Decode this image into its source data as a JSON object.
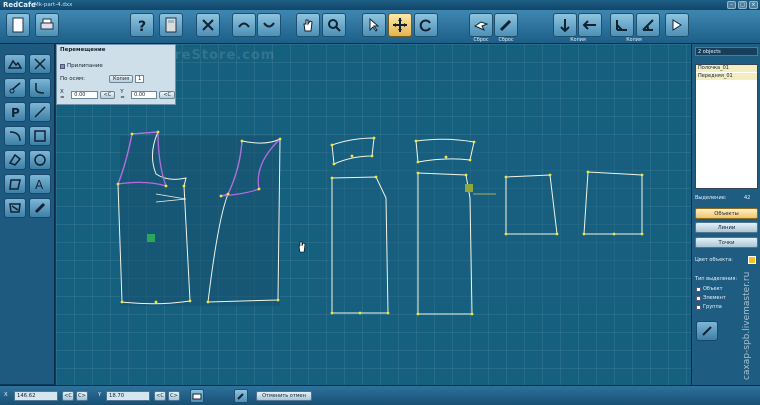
{
  "window": {
    "logo": "RedCafe",
    "file": "Mk-part-4.dxx"
  },
  "toolbar": {
    "label_reset_1": "Сброс",
    "label_reset_2": "Сброс",
    "label_copy_1": "Копия",
    "label_copy_2": "Копия"
  },
  "move_panel": {
    "title": "Перемещение",
    "snap_label": "Прилипание",
    "axes_label": "По осям:",
    "copy_button": "Копия",
    "copy_count": "1",
    "x_label": "X =",
    "x_value": "0.00",
    "y_label": "Y =",
    "y_value": "0.00",
    "c_button": "<C"
  },
  "canvas": {
    "watermark": "CareStore.com"
  },
  "right_panel": {
    "header": "2 objects",
    "objects": [
      "Полочка_01",
      "Передняя_01"
    ],
    "selection_label": "Выделение:",
    "selection_count": "42",
    "btn_objects": "Объекты",
    "btn_lines": "Линии",
    "btn_points": "Точки",
    "color_label": "Цвет объекта:",
    "color_value": "#f4c21e",
    "select_type_label": "Тип выделения:",
    "opt_object": "Объект",
    "opt_element": "Элемент",
    "opt_group": "Группа"
  },
  "bottom": {
    "x_label": "X",
    "x_value": "146.62",
    "y_label": "Y",
    "y_value": "18.70",
    "c_btn": "<C",
    "c_btn_r": "C>",
    "cancel_button": "Отменить отмен"
  },
  "site_watermark": "сахар-spb.livemaster.ru",
  "colors": {
    "canvas": "#16607f",
    "pattern_line": "#f1f4e6",
    "selected_line": "#b56be0",
    "point": "#f2e53b",
    "accent": "#f0c66a"
  }
}
